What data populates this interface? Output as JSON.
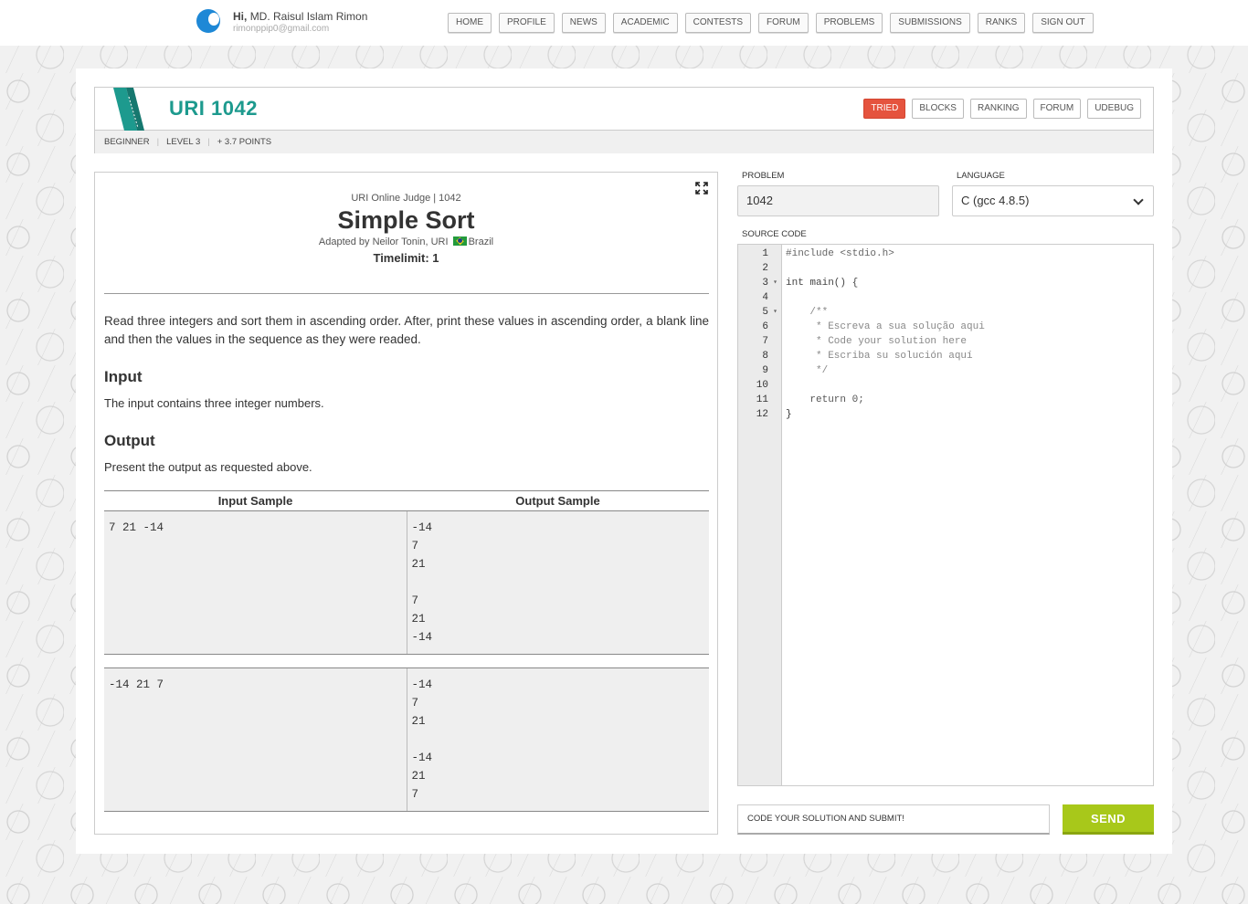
{
  "user": {
    "greeting": "Hi,",
    "name": "MD. Raisul Islam Rimon",
    "email": "rimonppip0@gmail.com"
  },
  "nav": [
    "HOME",
    "PROFILE",
    "NEWS",
    "ACADEMIC",
    "CONTESTS",
    "FORUM",
    "PROBLEMS",
    "SUBMISSIONS",
    "RANKS",
    "SIGN OUT"
  ],
  "header": {
    "title": "URI 1042",
    "buttons": [
      "TRIED",
      "BLOCKS",
      "RANKING",
      "FORUM",
      "UDEBUG"
    ],
    "category": "BEGINNER",
    "level": "LEVEL 3",
    "points": "+ 3.7 POINTS"
  },
  "problem": {
    "judge": "URI Online Judge | 1042",
    "title": "Simple Sort",
    "adapted_prefix": "Adapted by Neilor Tonin, URI",
    "country": "Brazil",
    "timelimit": "Timelimit: 1",
    "description": "Read three integers and sort them in ascending order. After, print these values in ascending order, a blank line and then the values in the sequence as they were readed.",
    "input_heading": "Input",
    "input_text": "The input contains three integer numbers.",
    "output_heading": "Output",
    "output_text": "Present the output as requested above.",
    "samples_header": {
      "input": "Input Sample",
      "output": "Output Sample"
    },
    "samples": [
      {
        "input": "7 21 -14",
        "output": "-14\n7\n21\n\n7\n21\n-14"
      },
      {
        "input": "-14 21 7",
        "output": "-14\n7\n21\n\n-14\n21\n7"
      }
    ]
  },
  "form": {
    "problem_label": "PROBLEM",
    "problem_value": "1042",
    "language_label": "LANGUAGE",
    "language_value": "C (gcc 4.8.5)",
    "source_label": "SOURCE CODE"
  },
  "code_lines": [
    "#include <stdio.h>",
    "",
    "int main() {",
    "",
    "    /**",
    "     * Escreva a sua solução aqui",
    "     * Code your solution here",
    "     * Escriba su solución aquí",
    "     */",
    "",
    "    return 0;",
    "}"
  ],
  "submit": {
    "placeholder": "CODE YOUR SOLUTION AND SUBMIT!",
    "send_label": "SEND"
  }
}
